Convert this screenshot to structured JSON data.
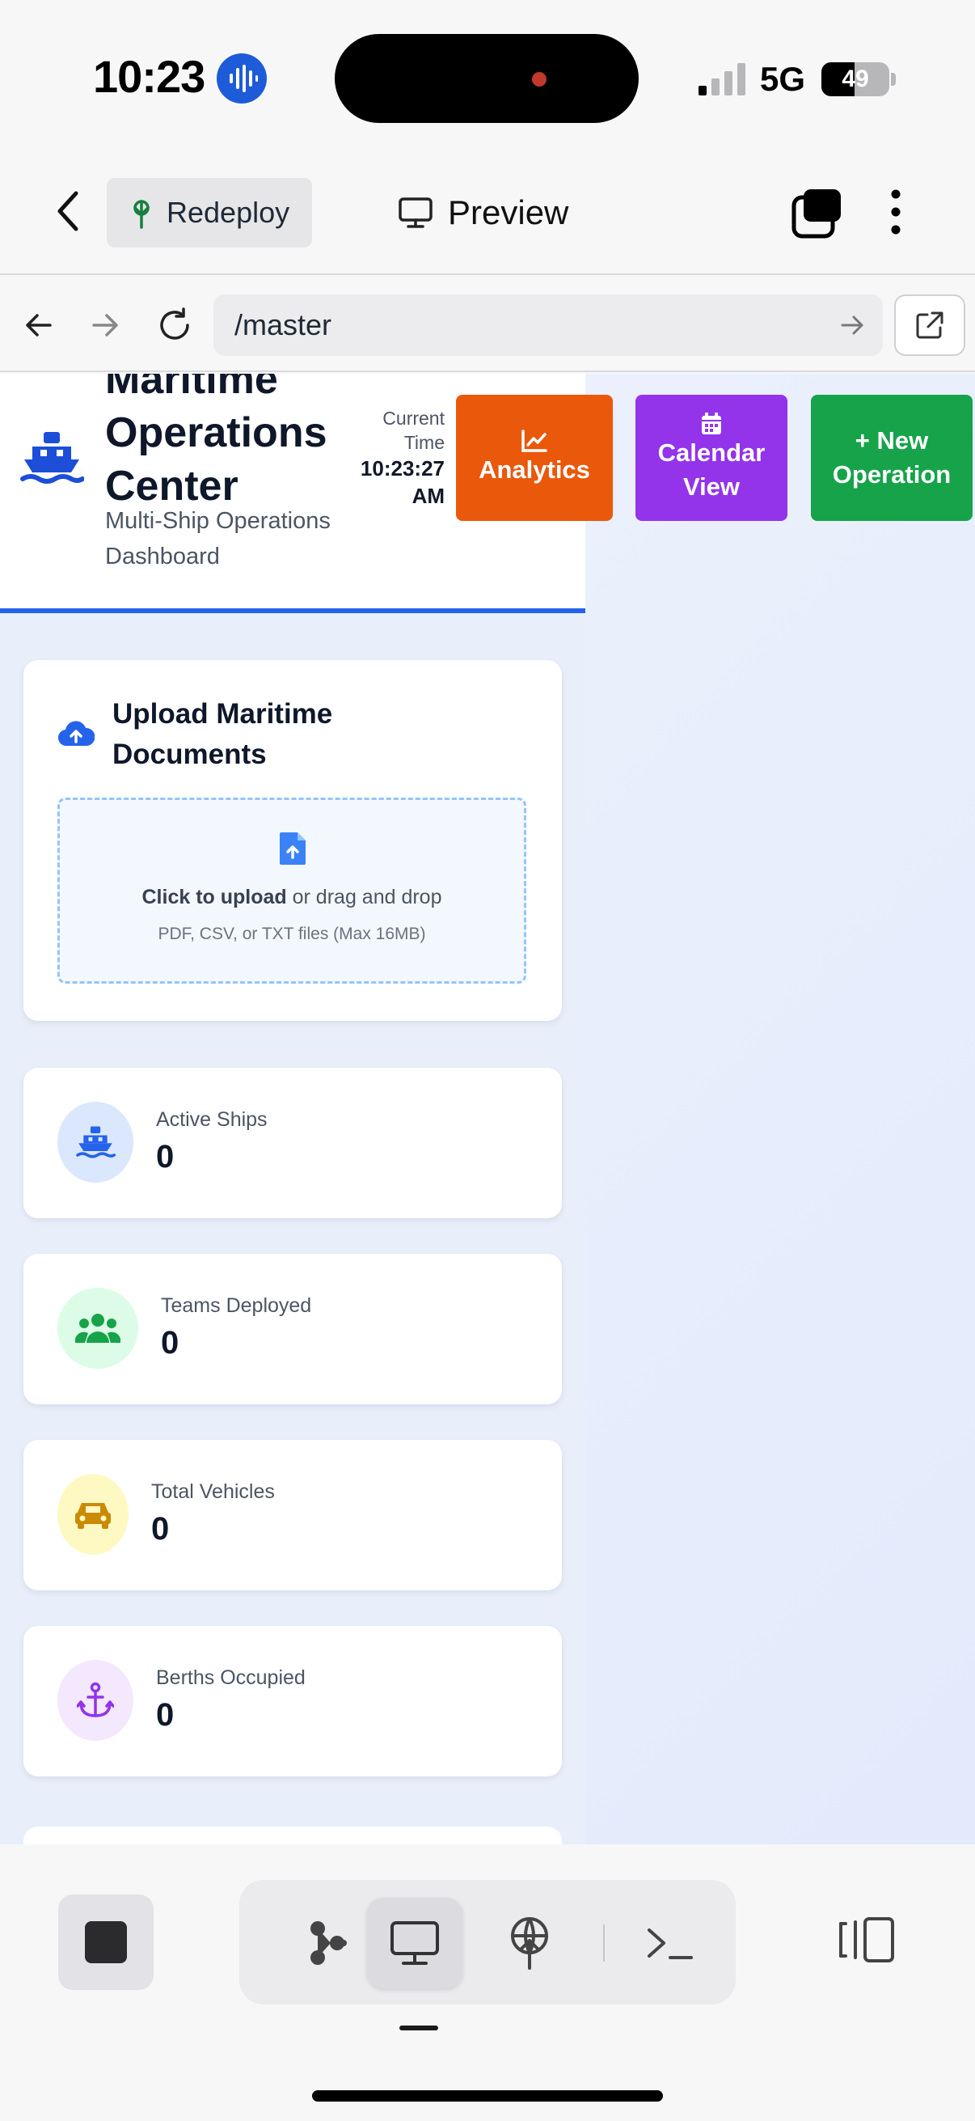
{
  "status_bar": {
    "time": "10:23",
    "network": "5G",
    "battery": "49",
    "battery_level": 0.49
  },
  "app_bar": {
    "redeploy_label": "Redeploy",
    "preview_label": "Preview"
  },
  "browser": {
    "url": "/master"
  },
  "dashboard": {
    "title": "Maritime Operations Center",
    "subtitle": "Multi-Ship Operations Dashboard",
    "time_label": "Current Time",
    "time_value": "10:23:27 AM",
    "buttons": {
      "analytics": "Analytics",
      "calendar": "Calendar View",
      "new_operation": "New Operation"
    },
    "upload": {
      "title": "Upload Maritime Documents",
      "click_text": "Click to upload",
      "drag_text": " or drag and drop",
      "hint": "PDF, CSV, or TXT files (Max 16MB)"
    },
    "stats": [
      {
        "label": "Active Ships",
        "value": "0",
        "icon": "ship-icon",
        "color": "#2563eb",
        "bg": "#dbe7fd"
      },
      {
        "label": "Teams Deployed",
        "value": "0",
        "icon": "users-icon",
        "color": "#16a34a",
        "bg": "#dcfce7"
      },
      {
        "label": "Total Vehicles",
        "value": "0",
        "icon": "car-icon",
        "color": "#ca8a04",
        "bg": "#fef9c3"
      },
      {
        "label": "Berths Occupied",
        "value": "0",
        "icon": "anchor-icon",
        "color": "#9333ea",
        "bg": "#f3e8ff"
      }
    ]
  },
  "colors": {
    "primary_blue": "#2563eb",
    "analytics_orange": "#ea580c",
    "calendar_purple": "#9333ea",
    "new_green": "#16a34a"
  }
}
